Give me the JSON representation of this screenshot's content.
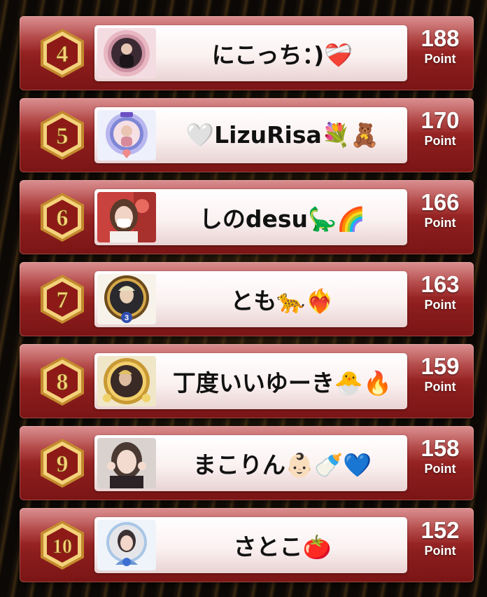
{
  "colors": {
    "row_top": "#c95a5c",
    "row_bottom": "#7a1515",
    "badge_gold": "#d9a441",
    "badge_red": "#8e1a17",
    "score_text": "#ffffff"
  },
  "rankings": [
    {
      "rank": "4",
      "name": "にこっち：)❤️‍🩹",
      "points": "188",
      "unit": "Point",
      "avatar": "avatar-pink-frame-icon"
    },
    {
      "rank": "5",
      "name": "🤍LizuRisa💐🧸",
      "points": "170",
      "unit": "Point",
      "avatar": "avatar-vip-frame-icon"
    },
    {
      "rank": "6",
      "name": "しのdesu🦕🌈",
      "points": "166",
      "unit": "Point",
      "avatar": "avatar-photo-icon"
    },
    {
      "rank": "7",
      "name": "とも🐆❤️‍🔥",
      "points": "163",
      "unit": "Point",
      "avatar": "avatar-gold-ring-icon"
    },
    {
      "rank": "8",
      "name": "丁度いいゆーき🐣🔥",
      "points": "159",
      "unit": "Point",
      "avatar": "avatar-gold-frame-icon"
    },
    {
      "rank": "9",
      "name": "まこりん👶🏻🍼💙",
      "points": "158",
      "unit": "Point",
      "avatar": "avatar-photo-icon"
    },
    {
      "rank": "10",
      "name": "さとこ🍅",
      "points": "152",
      "unit": "Point",
      "avatar": "avatar-blue-frame-icon"
    }
  ]
}
